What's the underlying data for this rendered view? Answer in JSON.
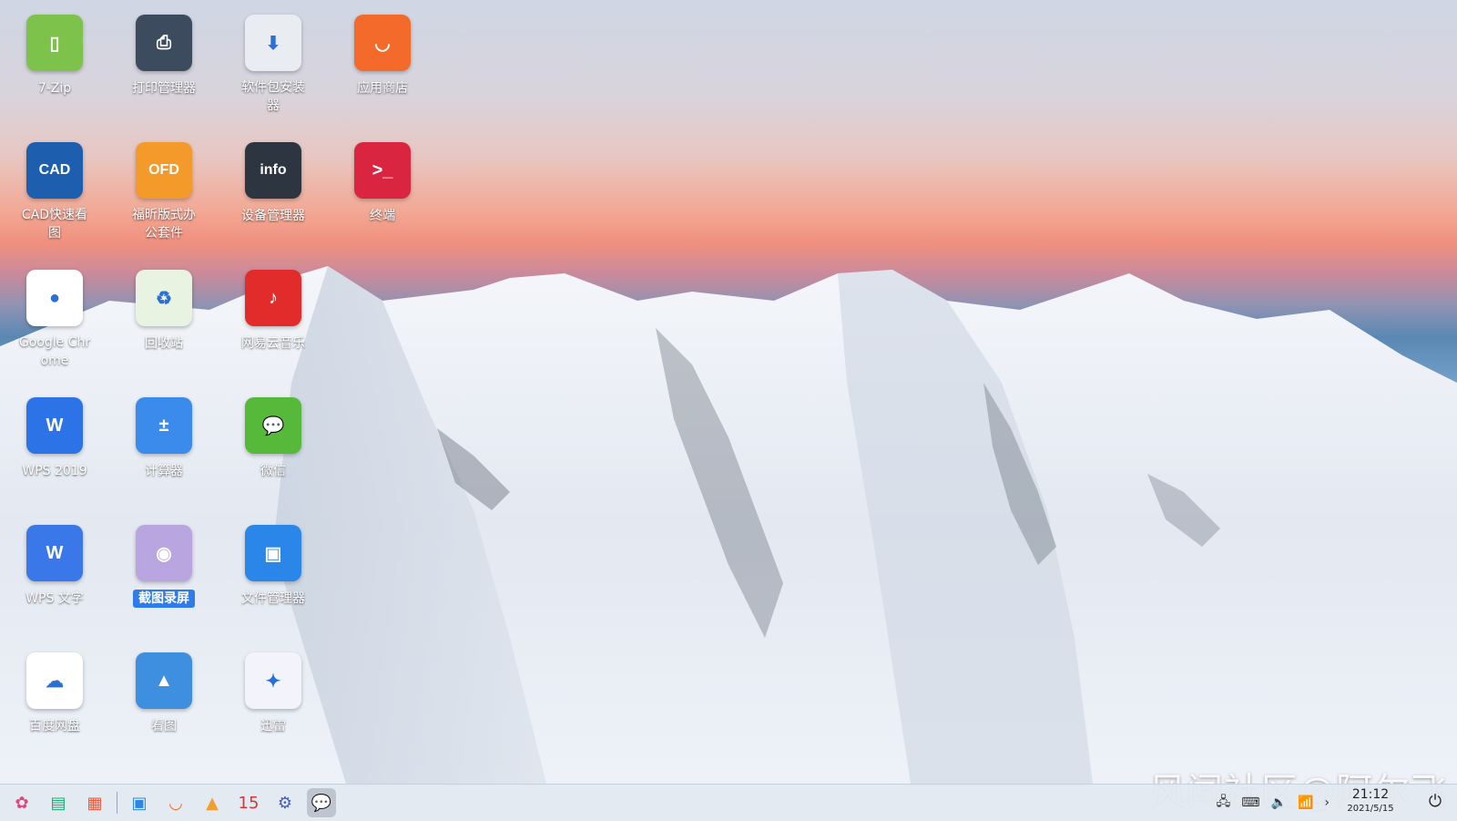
{
  "desktop": {
    "icons": [
      {
        "label": "7-Zip",
        "glyph": "▯",
        "color": "#7dc24a",
        "icon": "zip-archive-icon"
      },
      {
        "label": "打印管理器",
        "glyph": "⎙",
        "color": "#3c4b5e",
        "icon": "printer-icon"
      },
      {
        "label": "软件包安装器",
        "glyph": "⬇",
        "color": "#e9edf2",
        "icon": "package-install-icon"
      },
      {
        "label": "应用商店",
        "glyph": "◡",
        "color": "#f36a2b",
        "icon": "app-store-bag-icon"
      },
      {
        "label": "CAD快速看图",
        "glyph": "CAD",
        "color": "#1d5fae",
        "icon": "cad-viewer-icon"
      },
      {
        "label": "福昕版式办公套件",
        "glyph": "OFD",
        "color": "#f39a2a",
        "icon": "ofd-document-icon"
      },
      {
        "label": "设备管理器",
        "glyph": "info",
        "color": "#2c3540",
        "icon": "device-chip-icon"
      },
      {
        "label": "终端",
        "glyph": ">_",
        "color": "#d9253f",
        "icon": "terminal-icon"
      },
      {
        "label": "Google Chrome",
        "glyph": "●",
        "color": "#ffffff",
        "icon": "chrome-icon"
      },
      {
        "label": "回收站",
        "glyph": "♻",
        "color": "#e8f3e2",
        "icon": "recycle-bin-icon"
      },
      {
        "label": "网易云音乐",
        "glyph": "♪",
        "color": "#e22b2b",
        "icon": "netease-music-icon"
      },
      {
        "label": "WPS 2019",
        "glyph": "W",
        "color": "#2d73e8",
        "icon": "wps-2019-icon"
      },
      {
        "label": "计算器",
        "glyph": "±",
        "color": "#3a8bec",
        "icon": "calculator-icon"
      },
      {
        "label": "微信",
        "glyph": "💬",
        "color": "#56b93a",
        "icon": "wechat-icon"
      },
      {
        "label": "WPS 文字",
        "glyph": "W",
        "color": "#3a77e8",
        "icon": "wps-writer-icon"
      },
      {
        "label": "截图录屏",
        "glyph": "◉",
        "color": "#b9a6e0",
        "icon": "screenshot-camera-icon",
        "selected": true
      },
      {
        "label": "文件管理器",
        "glyph": "▣",
        "color": "#2a86e8",
        "icon": "file-manager-icon"
      },
      {
        "label": "百度网盘",
        "glyph": "☁",
        "color": "#ffffff",
        "icon": "baidu-netdisk-icon"
      },
      {
        "label": "看图",
        "glyph": "▲",
        "color": "#3f8fe0",
        "icon": "image-viewer-icon"
      },
      {
        "label": "迅雷",
        "glyph": "✦",
        "color": "#f3f3fb",
        "icon": "xunlei-bird-icon"
      }
    ]
  },
  "taskbar": {
    "items": [
      {
        "icon": "launcher-icon",
        "glyph": "✿",
        "color": "#e0457b"
      },
      {
        "icon": "multitask-view-icon",
        "glyph": "▤",
        "color": "#19a974"
      },
      {
        "icon": "app-grid-icon",
        "glyph": "▦",
        "color": "#f05a3a"
      },
      {
        "icon": "file-manager-taskbar-icon",
        "glyph": "▣",
        "color": "#2a86e8"
      },
      {
        "icon": "app-store-taskbar-icon",
        "glyph": "◡",
        "color": "#f36a2b"
      },
      {
        "icon": "image-viewer-taskbar-icon",
        "glyph": "▲",
        "color": "#f0a030"
      },
      {
        "icon": "calendar-taskbar-icon",
        "glyph": "15",
        "color": "#d33"
      },
      {
        "icon": "settings-taskbar-icon",
        "glyph": "⚙",
        "color": "#4a5db5"
      },
      {
        "icon": "wechat-taskbar-icon",
        "glyph": "💬",
        "color": "#56b93a",
        "active": true
      }
    ],
    "tray": [
      {
        "icon": "network-status-icon",
        "glyph": "🖧"
      },
      {
        "icon": "keyboard-icon",
        "glyph": "⌨"
      },
      {
        "icon": "volume-icon",
        "glyph": "🔈"
      },
      {
        "icon": "wifi-icon",
        "glyph": "📶"
      },
      {
        "icon": "tray-expand-icon",
        "glyph": "›"
      }
    ],
    "clock": {
      "time": "21:12",
      "date": "2021/5/15"
    },
    "power_glyph": "⏻"
  },
  "watermark": "风闻社区@阿尔飞"
}
